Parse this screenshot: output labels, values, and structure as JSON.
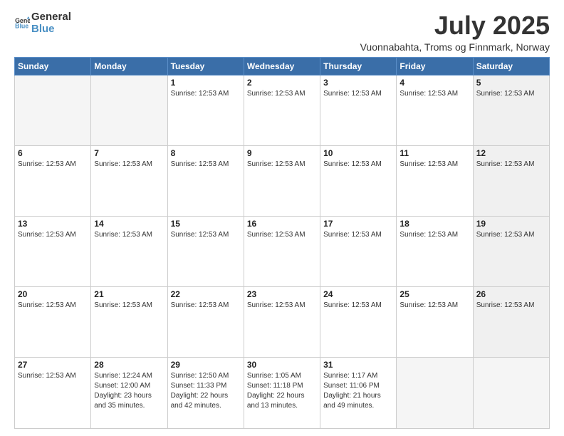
{
  "logo": {
    "line1": "General",
    "line2": "Blue",
    "icon_color": "#4a90c4"
  },
  "header": {
    "month_year": "July 2025",
    "location": "Vuonnabahta, Troms og Finnmark, Norway"
  },
  "weekdays": [
    "Sunday",
    "Monday",
    "Tuesday",
    "Wednesday",
    "Thursday",
    "Friday",
    "Saturday"
  ],
  "weeks": [
    [
      {
        "day": "",
        "info": "",
        "empty": true
      },
      {
        "day": "",
        "info": "",
        "empty": true
      },
      {
        "day": "1",
        "info": "Sunrise: 12:53 AM",
        "empty": false
      },
      {
        "day": "2",
        "info": "Sunrise: 12:53 AM",
        "empty": false
      },
      {
        "day": "3",
        "info": "Sunrise: 12:53 AM",
        "empty": false
      },
      {
        "day": "4",
        "info": "Sunrise: 12:53 AM",
        "empty": false
      },
      {
        "day": "5",
        "info": "Sunrise: 12:53 AM",
        "empty": false,
        "shaded": true
      }
    ],
    [
      {
        "day": "6",
        "info": "Sunrise: 12:53 AM",
        "empty": false
      },
      {
        "day": "7",
        "info": "Sunrise: 12:53 AM",
        "empty": false
      },
      {
        "day": "8",
        "info": "Sunrise: 12:53 AM",
        "empty": false
      },
      {
        "day": "9",
        "info": "Sunrise: 12:53 AM",
        "empty": false
      },
      {
        "day": "10",
        "info": "Sunrise: 12:53 AM",
        "empty": false
      },
      {
        "day": "11",
        "info": "Sunrise: 12:53 AM",
        "empty": false
      },
      {
        "day": "12",
        "info": "Sunrise: 12:53 AM",
        "empty": false,
        "shaded": true
      }
    ],
    [
      {
        "day": "13",
        "info": "Sunrise: 12:53 AM",
        "empty": false
      },
      {
        "day": "14",
        "info": "Sunrise: 12:53 AM",
        "empty": false
      },
      {
        "day": "15",
        "info": "Sunrise: 12:53 AM",
        "empty": false
      },
      {
        "day": "16",
        "info": "Sunrise: 12:53 AM",
        "empty": false
      },
      {
        "day": "17",
        "info": "Sunrise: 12:53 AM",
        "empty": false
      },
      {
        "day": "18",
        "info": "Sunrise: 12:53 AM",
        "empty": false
      },
      {
        "day": "19",
        "info": "Sunrise: 12:53 AM",
        "empty": false,
        "shaded": true
      }
    ],
    [
      {
        "day": "20",
        "info": "Sunrise: 12:53 AM",
        "empty": false
      },
      {
        "day": "21",
        "info": "Sunrise: 12:53 AM",
        "empty": false
      },
      {
        "day": "22",
        "info": "Sunrise: 12:53 AM",
        "empty": false
      },
      {
        "day": "23",
        "info": "Sunrise: 12:53 AM",
        "empty": false
      },
      {
        "day": "24",
        "info": "Sunrise: 12:53 AM",
        "empty": false
      },
      {
        "day": "25",
        "info": "Sunrise: 12:53 AM",
        "empty": false
      },
      {
        "day": "26",
        "info": "Sunrise: 12:53 AM",
        "empty": false,
        "shaded": true
      }
    ],
    [
      {
        "day": "27",
        "info": "Sunrise: 12:53 AM",
        "empty": false
      },
      {
        "day": "28",
        "info": "Sunrise: 12:24 AM\nSunset: 12:00 AM\nDaylight: 23 hours and 35 minutes.",
        "empty": false
      },
      {
        "day": "29",
        "info": "Sunrise: 12:50 AM\nSunset: 11:33 PM\nDaylight: 22 hours and 42 minutes.",
        "empty": false
      },
      {
        "day": "30",
        "info": "Sunrise: 1:05 AM\nSunset: 11:18 PM\nDaylight: 22 hours and 13 minutes.",
        "empty": false
      },
      {
        "day": "31",
        "info": "Sunrise: 1:17 AM\nSunset: 11:06 PM\nDaylight: 21 hours and 49 minutes.",
        "empty": false
      },
      {
        "day": "",
        "info": "",
        "empty": true
      },
      {
        "day": "",
        "info": "",
        "empty": true,
        "shaded": true
      }
    ]
  ]
}
